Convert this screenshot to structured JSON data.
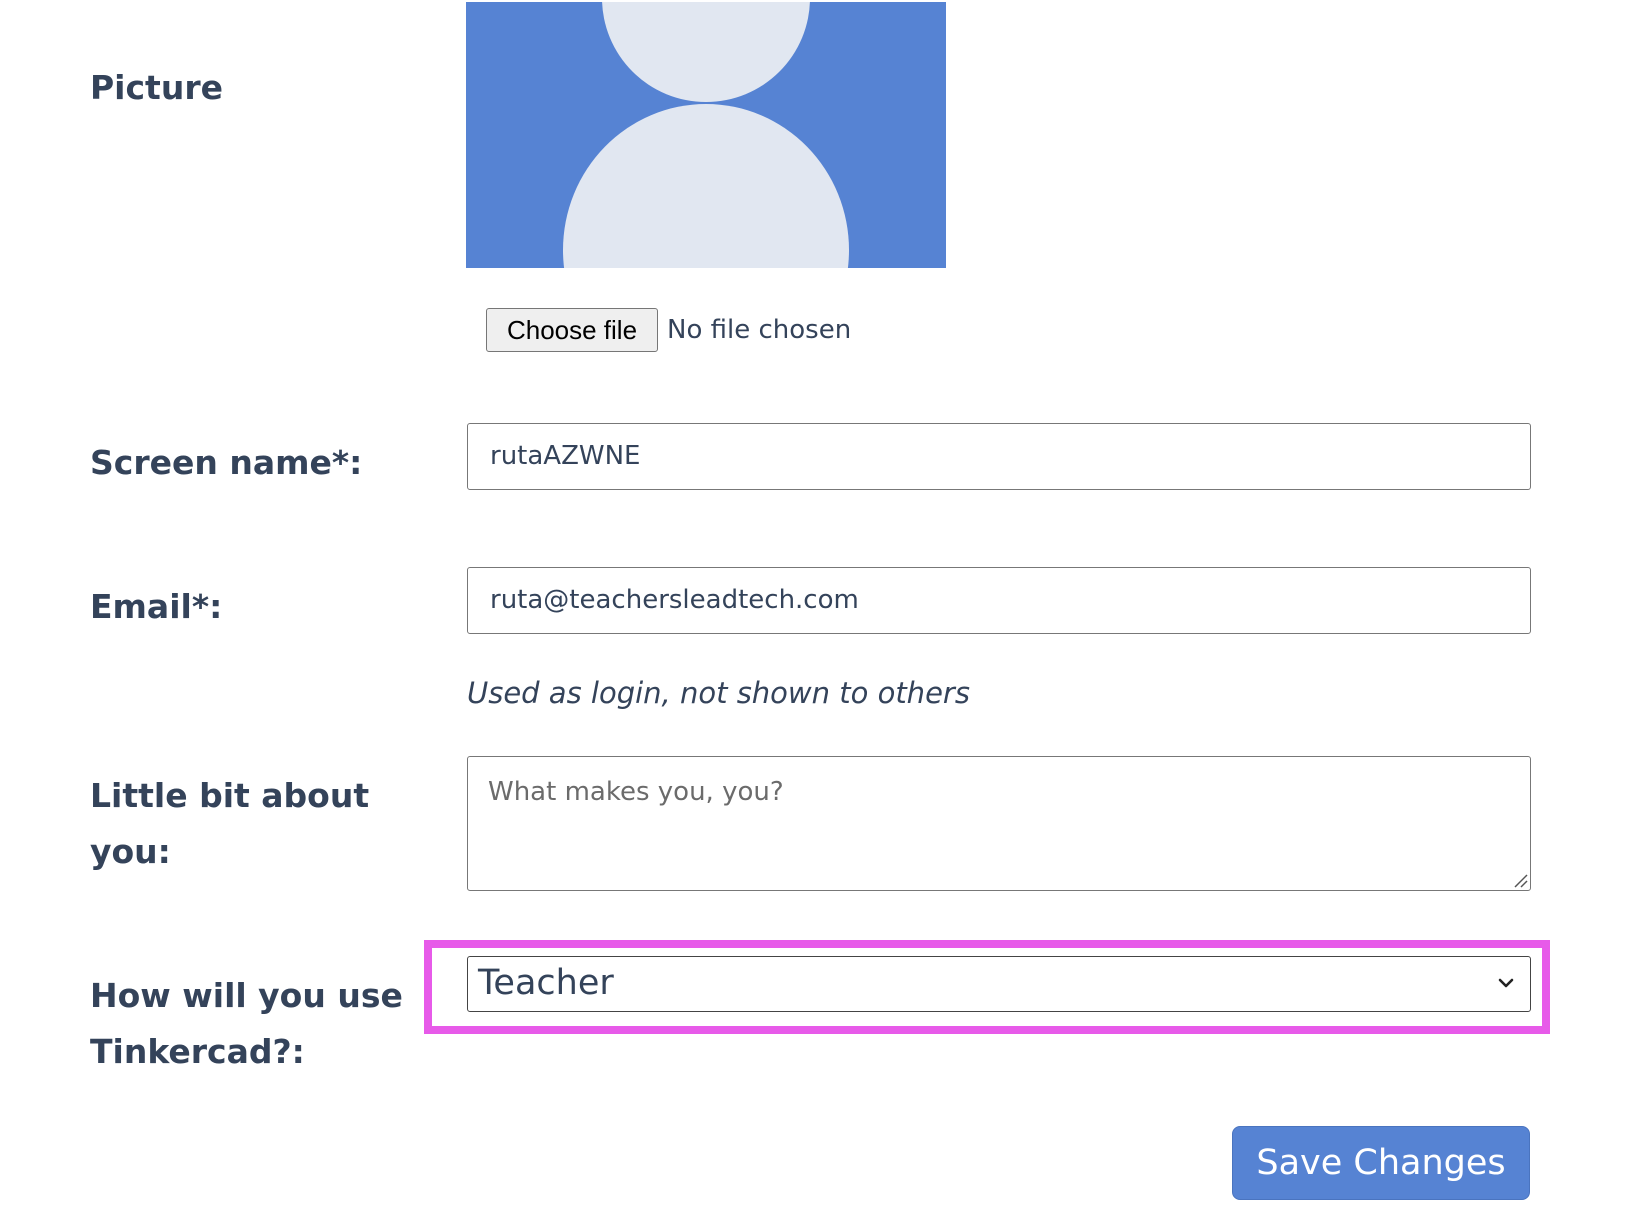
{
  "picture": {
    "label": "Picture",
    "avatar_color": "#5683d3",
    "silhouette_color": "#e1e7f1",
    "choose_file_label": "Choose file",
    "file_status": "No file chosen"
  },
  "screen_name": {
    "label": "Screen name*:",
    "value": "rutaAZWNE"
  },
  "email": {
    "label": "Email*:",
    "value": "ruta@teachersleadtech.com",
    "hint": "Used as login, not shown to others"
  },
  "about": {
    "label_line1": "Little bit about",
    "label_line2": "you:",
    "placeholder": "What makes you, you?",
    "value": ""
  },
  "usage": {
    "label_line1": "How will you use",
    "label_line2": "Tinkercad?:",
    "selected": "Teacher",
    "highlight_color": "#e75ae9"
  },
  "actions": {
    "save_label": "Save Changes",
    "save_color": "#5683d3"
  }
}
